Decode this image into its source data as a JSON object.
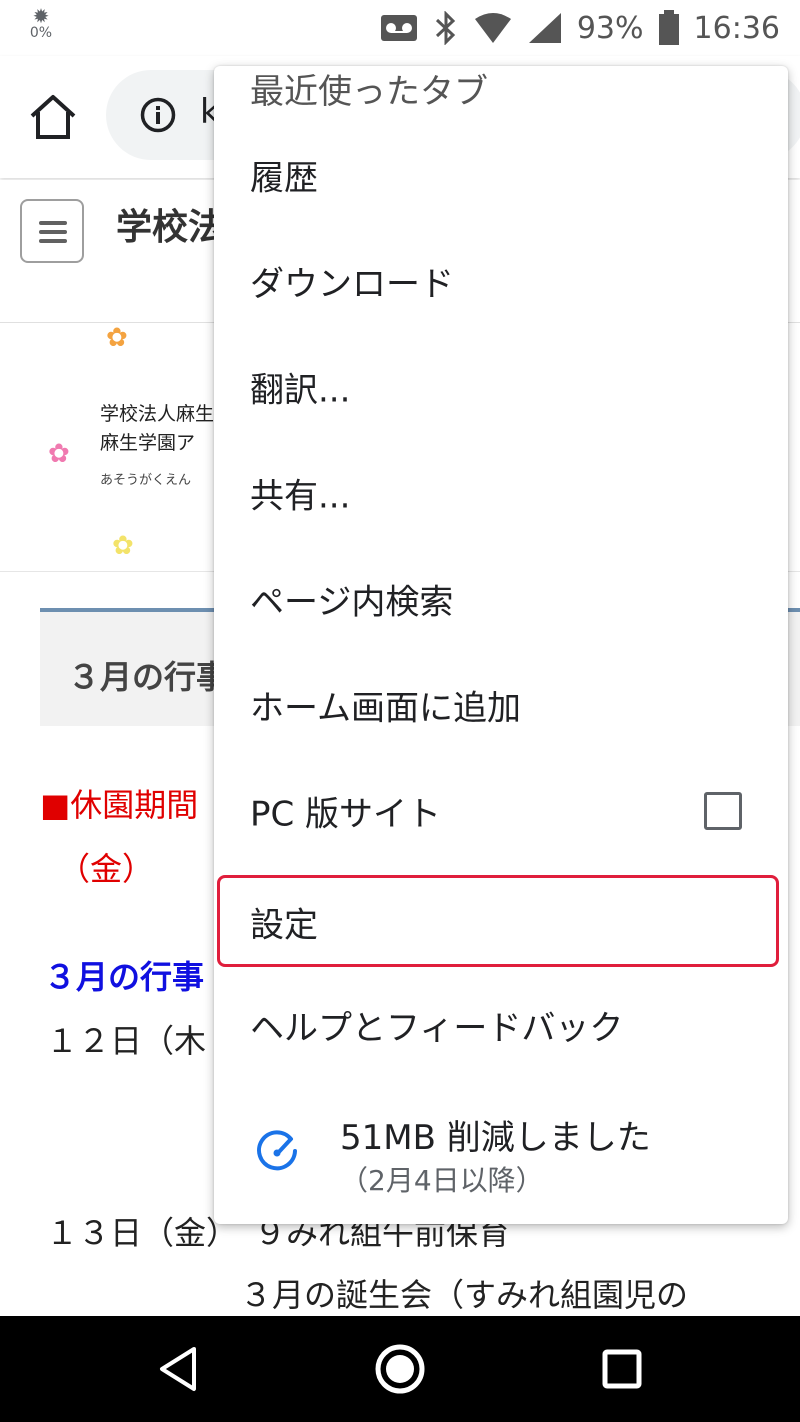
{
  "status_bar": {
    "brightness_icon": "gear-icon",
    "brightness_pct": "0%",
    "icons": [
      "voicemail-icon",
      "bluetooth-icon",
      "wifi-icon",
      "cell-signal-icon"
    ],
    "battery_pct": "93%",
    "time": "16:36"
  },
  "toolbar": {
    "home_icon": "home-icon",
    "info_icon": "info-icon",
    "url_text": "k"
  },
  "page": {
    "site_title": "学校法",
    "banner_line1": "学校法人麻生",
    "banner_line2": "麻生学園ア",
    "banner_kana": "あそうがくえん",
    "month_box_title": "３月の行事",
    "closure_line": "■休園期間",
    "closure_line2": "（金）",
    "events_heading": "３月の行事",
    "event_12": "１２日（木",
    "event_13": "１３日（金）　９みれ組午前保育",
    "birthday_line": "３月の誕生会（すみれ組園児の"
  },
  "menu": {
    "items": [
      {
        "label": "最近使ったタブ"
      },
      {
        "label": "履歴"
      },
      {
        "label": "ダウンロード"
      },
      {
        "label": "翻訳..."
      },
      {
        "label": "共有..."
      },
      {
        "label": "ページ内検索"
      },
      {
        "label": "ホーム画面に追加"
      },
      {
        "label": "PC 版サイト"
      },
      {
        "label": "設定"
      },
      {
        "label": "ヘルプとフィードバック"
      }
    ],
    "desktop_site_checked": false,
    "highlighted_item": "設定",
    "savings_main": "51MB 削減しました",
    "savings_sub": "（2月4日以降）"
  },
  "colors": {
    "highlight_border": "#e01e3c",
    "savings_icon": "#1a73e8",
    "red_text": "#e00000",
    "blue_text": "#1010e0"
  },
  "navbar": {
    "buttons": [
      "back-icon",
      "home-circle-icon",
      "recents-icon"
    ]
  }
}
